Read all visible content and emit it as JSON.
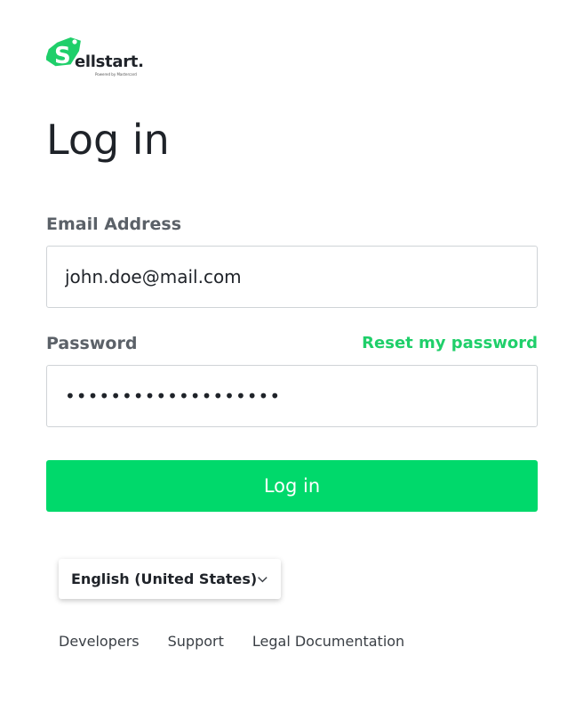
{
  "brand": {
    "logo_text": "ellstart.",
    "logo_subtext": "Powered by Mastercard",
    "accent_color": "#00d96b",
    "link_color": "#1fcf6a"
  },
  "page": {
    "title": "Log in"
  },
  "form": {
    "email_label": "Email Address",
    "email_value": "john.doe@mail.com",
    "password_label": "Password",
    "password_value": "•••••••••••••••••••",
    "reset_link": "Reset my password",
    "submit_label": "Log in"
  },
  "language": {
    "selected": "English (United States)",
    "icon": "chevron-down-icon"
  },
  "footer": {
    "links": [
      "Developers",
      "Support",
      "Legal Documentation"
    ]
  }
}
